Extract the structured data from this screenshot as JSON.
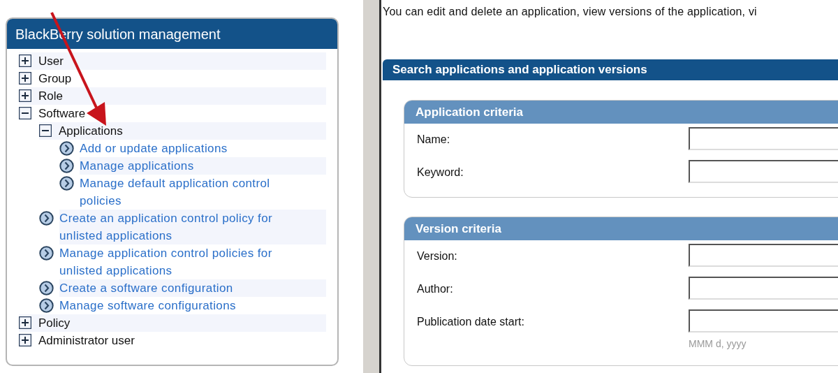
{
  "panel": {
    "title": "BlackBerry solution management",
    "tree": [
      {
        "kind": "group",
        "label": "User",
        "expanded": false
      },
      {
        "kind": "group",
        "label": "Group",
        "expanded": false
      },
      {
        "kind": "group",
        "label": "Role",
        "expanded": false
      },
      {
        "kind": "group",
        "label": "Software",
        "expanded": true,
        "children": [
          {
            "kind": "group",
            "label": "Applications",
            "expanded": true,
            "children": [
              {
                "kind": "link",
                "label": "Add or update applications"
              },
              {
                "kind": "link",
                "label": "Manage applications"
              },
              {
                "kind": "link",
                "label": "Manage default application control policies"
              }
            ]
          },
          {
            "kind": "link",
            "label": "Create an application control policy for unlisted applications"
          },
          {
            "kind": "link",
            "label": "Manage application control policies for unlisted applications"
          },
          {
            "kind": "link",
            "label": "Create a software configuration"
          },
          {
            "kind": "link",
            "label": "Manage software configurations"
          }
        ]
      },
      {
        "kind": "group",
        "label": "Policy",
        "expanded": false
      },
      {
        "kind": "group",
        "label": "Administrator user",
        "expanded": false
      }
    ]
  },
  "intro": "You can edit and delete an application, view versions of the application, vi",
  "search": {
    "title": "Search applications and application versions",
    "sections": [
      {
        "title": "Application criteria",
        "fields": [
          {
            "label": "Name:"
          },
          {
            "label": "Keyword:"
          }
        ]
      },
      {
        "title": "Version criteria",
        "fields": [
          {
            "label": "Version:"
          },
          {
            "label": "Author:"
          },
          {
            "label": "Publication date start:",
            "hint": "MMM d, yyyy"
          }
        ]
      }
    ]
  }
}
